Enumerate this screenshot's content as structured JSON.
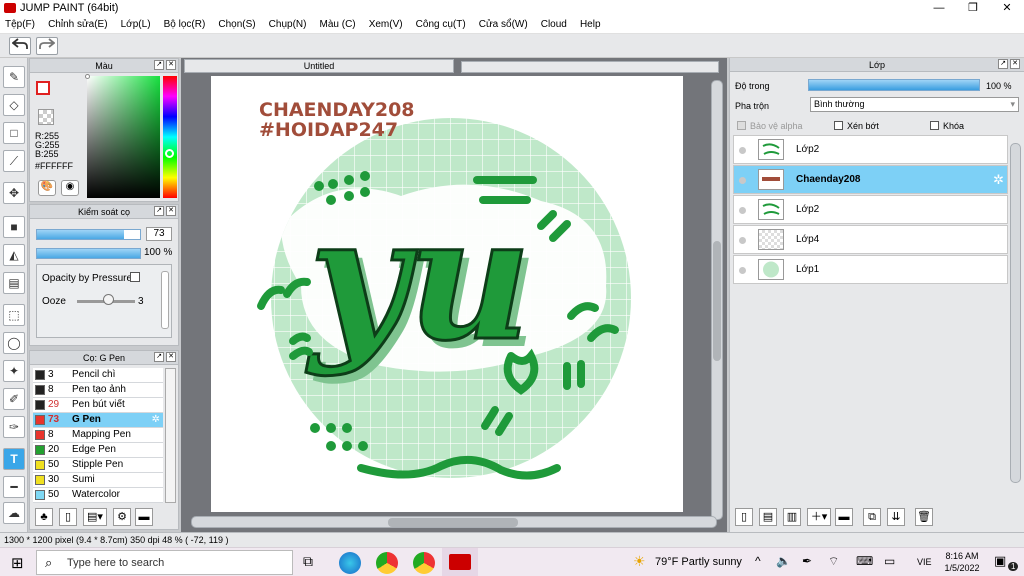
{
  "window": {
    "title": "JUMP PAINT (64bit)",
    "minimize": "—",
    "restore": "❐",
    "close": "✕"
  },
  "menu": [
    "Tệp(F)",
    "Chỉnh sửa(E)",
    "Lớp(L)",
    "Bộ lọc(R)",
    "Chọn(S)",
    "Chụp(N)",
    "Màu (C)",
    "Xem(V)",
    "Công cụ(T)",
    "Cửa sổ(W)",
    "Cloud",
    "Help"
  ],
  "toolbar": {
    "undo_icon": "undo-icon",
    "redo_icon": "redo-icon"
  },
  "color_panel": {
    "title": "Màu",
    "r": "R:255",
    "g": "G:255",
    "b": "B:255",
    "hex": "#FFFFFF"
  },
  "brush_control": {
    "title": "Kiểm soát cọ",
    "size_value": "73",
    "opacity_value": "100 %",
    "opacity_pressure_label": "Opacity by Pressure",
    "ooze_label": "Ooze",
    "ooze_value": "3",
    "size_fill": 0.84,
    "opacity_fill": 1.0
  },
  "brush_list": {
    "title": "Cọ: G Pen",
    "items": [
      {
        "size": "3",
        "name": "Pencil chì",
        "color": "#222222"
      },
      {
        "size": "8",
        "name": "Pen tạo ảnh",
        "color": "#222222"
      },
      {
        "size": "29",
        "name": "Pen bút viết",
        "color": "#222222"
      },
      {
        "size": "73",
        "name": "G Pen",
        "color": "#e8342c",
        "selected": true
      },
      {
        "size": "8",
        "name": "Mapping Pen",
        "color": "#e8342c"
      },
      {
        "size": "20",
        "name": "Edge Pen",
        "color": "#22a030"
      },
      {
        "size": "50",
        "name": "Stipple Pen",
        "color": "#f0e020"
      },
      {
        "size": "30",
        "name": "Sumi",
        "color": "#f0e020"
      },
      {
        "size": "50",
        "name": "Watercolor",
        "color": "#7fd8f4"
      }
    ]
  },
  "canvas": {
    "tab_title": "Untitled",
    "art_text_1": "CHAENDAY208",
    "art_text_2": "#HOIDAP247",
    "art_word": "yu"
  },
  "layers": {
    "title": "Lớp",
    "opacity_label": "Độ trong",
    "opacity_value": "100 %",
    "opacity_fill": 1.0,
    "blend_label": "Pha trộn",
    "blend_value": "Bình thường",
    "protect_alpha": "Bảo vệ alpha",
    "clip": "Xén bớt",
    "lock": "Khóa",
    "items": [
      {
        "name": "Lớp2",
        "selected": false
      },
      {
        "name": "Chaenday208",
        "selected": true
      },
      {
        "name": "Lớp2",
        "selected": false
      },
      {
        "name": "Lớp4",
        "selected": false
      },
      {
        "name": "Lớp1",
        "selected": false
      }
    ]
  },
  "status": {
    "text": "1300 * 1200 pixel  (9.4 * 8.7cm)  350 dpi  48 %  ( -72, 119 )"
  },
  "taskbar": {
    "search_placeholder": "Type here to search",
    "weather": "79°F  Partly sunny",
    "lang": "VIE",
    "time": "8:16 AM",
    "date": "1/5/2022",
    "notif_count": "1"
  }
}
